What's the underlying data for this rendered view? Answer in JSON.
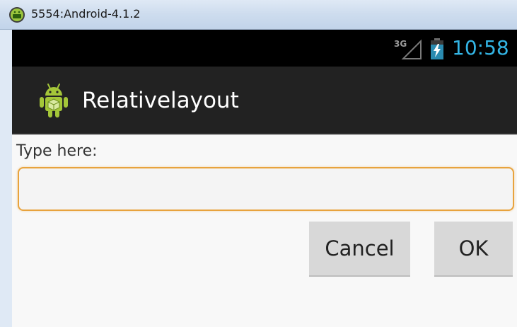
{
  "emulator": {
    "window_title": "5554:Android-4.1.2",
    "icon": "android-emulator-icon"
  },
  "status_bar": {
    "network": "3G",
    "signal_icon": "signal-icon",
    "battery_icon": "battery-charging-icon",
    "time": "10:58",
    "clock_color": "#33b5e5"
  },
  "action_bar": {
    "app_icon": "android-robot-icon",
    "title": "Relativelayout"
  },
  "form": {
    "label": "Type here:",
    "entry_value": "",
    "entry_focus_color": "#e8a33d",
    "cancel_label": "Cancel",
    "ok_label": "OK"
  }
}
